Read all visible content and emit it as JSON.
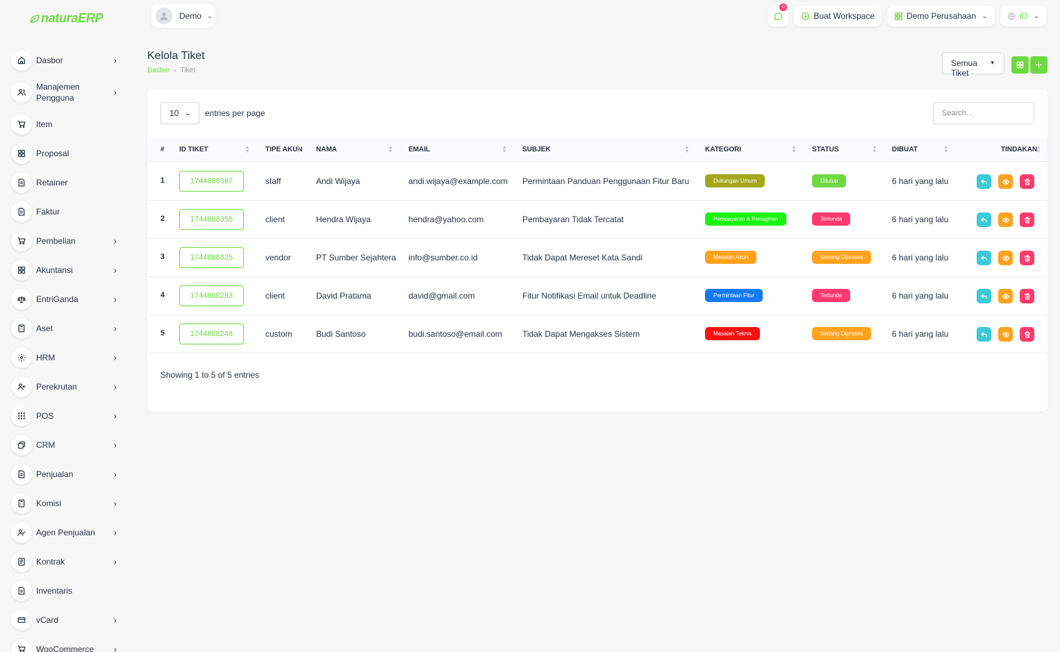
{
  "app": {
    "logo_prefix": "natura",
    "logo_suffix": "ERP"
  },
  "sidebar": {
    "items": [
      {
        "label": "Dasbor",
        "icon": "home-icon",
        "chevron": true
      },
      {
        "label": "Manajemen Pengguna",
        "icon": "users-icon",
        "chevron": true
      },
      {
        "label": "Item",
        "icon": "cart-icon",
        "chevron": false
      },
      {
        "label": "Proposal",
        "icon": "grid-icon",
        "chevron": false
      },
      {
        "label": "Retainer",
        "icon": "file-icon",
        "chevron": false
      },
      {
        "label": "Faktur",
        "icon": "file-icon",
        "chevron": false
      },
      {
        "label": "Pembelian",
        "icon": "cart-icon",
        "chevron": true
      },
      {
        "label": "Akuntansi",
        "icon": "grid-icon",
        "chevron": true
      },
      {
        "label": "EntriGanda",
        "icon": "scale-icon",
        "chevron": true
      },
      {
        "label": "Aset",
        "icon": "calculator-icon",
        "chevron": true
      },
      {
        "label": "HRM",
        "icon": "hrm-icon",
        "chevron": true
      },
      {
        "label": "Perekrutan",
        "icon": "user-plus-icon",
        "chevron": true
      },
      {
        "label": "POS",
        "icon": "dots-grid-icon",
        "chevron": true
      },
      {
        "label": "CRM",
        "icon": "crm-icon",
        "chevron": true
      },
      {
        "label": "Penjualan",
        "icon": "file-icon",
        "chevron": true
      },
      {
        "label": "Komisi",
        "icon": "calculator-icon",
        "chevron": true
      },
      {
        "label": "Agen Penjualan",
        "icon": "user-check-icon",
        "chevron": true
      },
      {
        "label": "Kontrak",
        "icon": "contract-icon",
        "chevron": true
      },
      {
        "label": "Inventaris",
        "icon": "file-icon",
        "chevron": false
      },
      {
        "label": "vCard",
        "icon": "card-icon",
        "chevron": true
      },
      {
        "label": "WooCommerce",
        "icon": "cart-icon",
        "chevron": true
      }
    ]
  },
  "topbar": {
    "user_name": "Demo",
    "notification_count": "0",
    "create_workspace": "Buat Workspace",
    "company": "Demo Perusahaan",
    "language": "ID"
  },
  "page": {
    "title": "Kelola Tiket",
    "breadcrumb": [
      "Dasbor",
      "Tiket"
    ],
    "filter_value": "Semua Tiket"
  },
  "table": {
    "per_page": "10",
    "per_page_label": "entries per page",
    "search_placeholder": "Search...",
    "columns": [
      "#",
      "ID TIKET",
      "TIPE AKUN",
      "NAMA",
      "EMAIL",
      "SUBJEK",
      "KATEGORI",
      "STATUS",
      "DIBUAT",
      "TINDAKAN"
    ],
    "rows": [
      {
        "no": "1",
        "id": "1744888387",
        "type": "staff",
        "name": "Andi Wijaya",
        "email": "andi.wijaya@example.com",
        "subject": "Permintaan Panduan Penggunaan Fitur Baru",
        "category": "Dukungan Umum",
        "category_color": "#a4a81c",
        "status": "Ditutup",
        "status_color": "#6fd943",
        "created": "6 hari yang lalu"
      },
      {
        "no": "2",
        "id": "1744888355",
        "type": "client",
        "name": "Hendra Wijaya",
        "email": "hendra@yahoo.com",
        "subject": "Pembayaran Tidak Tercatat",
        "category": "Pembayaran & Penagihan",
        "category_color": "#17f50f",
        "status": "Tertunda",
        "status_color": "#ff3a6e",
        "created": "6 hari yang lalu"
      },
      {
        "no": "3",
        "id": "1744888325",
        "type": "vendor",
        "name": "PT Sumber Sejahtera",
        "email": "info@sumber.co.id",
        "subject": "Tidak Dapat Mereset Kata Sandi",
        "category": "Masalah Akun",
        "category_color": "#ffa21d",
        "status": "Sedang Diproses",
        "status_color": "#ffa21d",
        "created": "6 hari yang lalu"
      },
      {
        "no": "4",
        "id": "1744888293",
        "type": "client",
        "name": "David Pratama",
        "email": "david@gmail.com",
        "subject": "Fitur Notifikasi Email untuk Deadline",
        "category": "Permintaan Fitur",
        "category_color": "#1479f5",
        "status": "Tertunda",
        "status_color": "#ff3a6e",
        "created": "6 hari yang lalu"
      },
      {
        "no": "5",
        "id": "1744888248",
        "type": "custom",
        "name": "Budi Santoso",
        "email": "budi.santoso@email.com",
        "subject": "Tidak Dapat Mengakses Sistem",
        "category": "Masalah Teknis",
        "category_color": "#f5120f",
        "status": "Sedang Diproses",
        "status_color": "#ffa21d",
        "created": "6 hari yang lalu"
      }
    ],
    "footer": "Showing 1 to 5 of 5 entries"
  }
}
